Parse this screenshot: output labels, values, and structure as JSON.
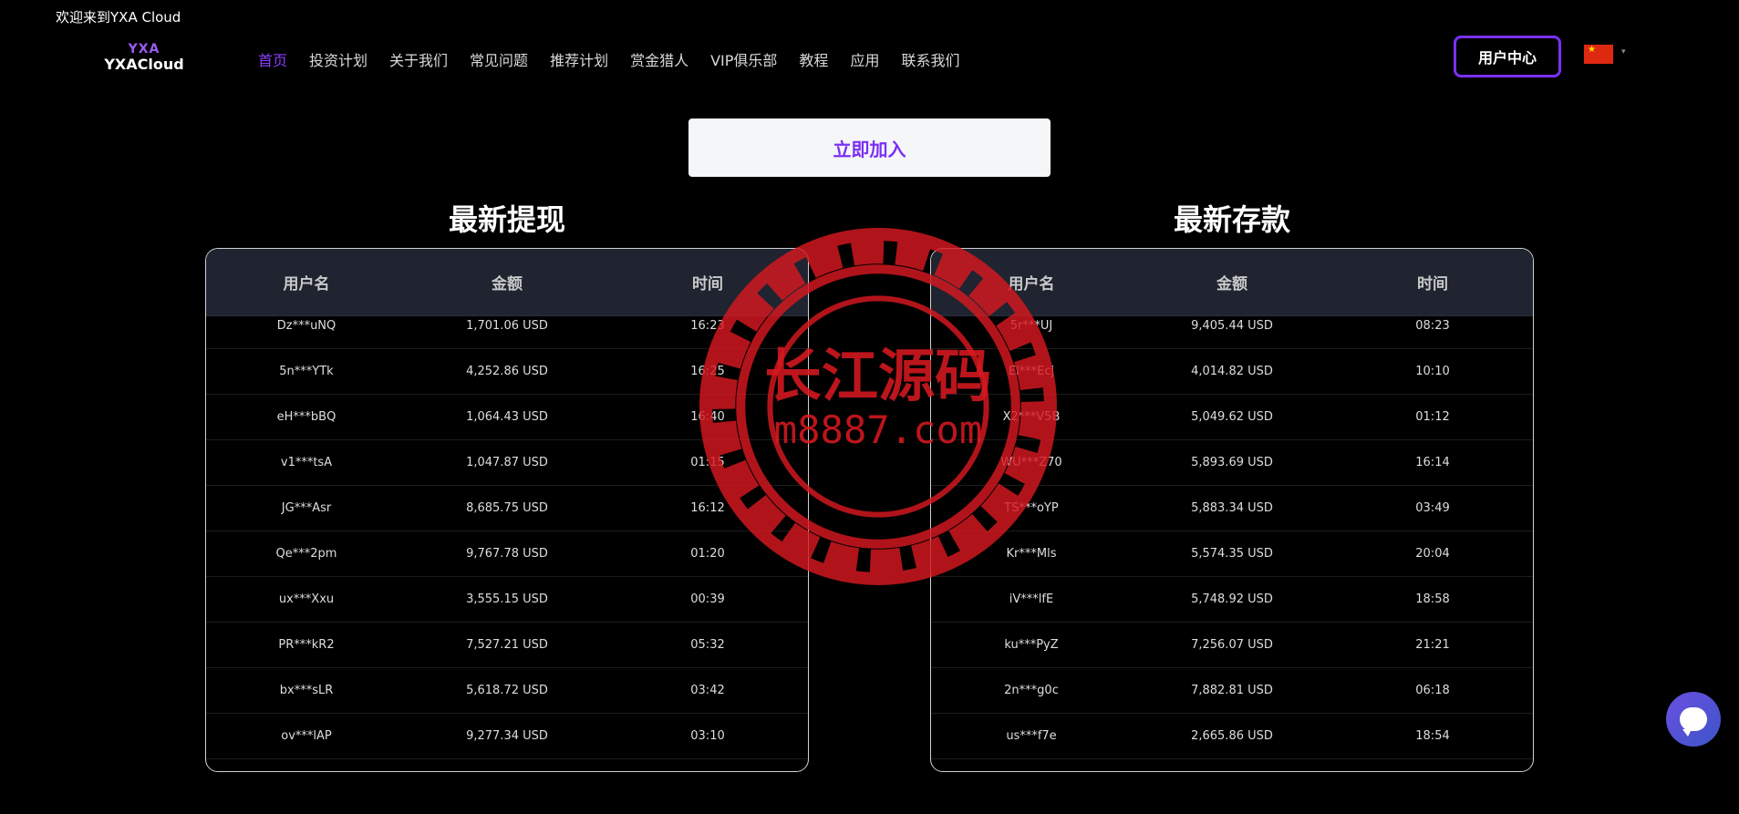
{
  "header": {
    "welcome": "欢迎来到YXA Cloud",
    "logo_top": "YXA",
    "logo_bottom": "YXACloud",
    "user_center": "用户中心"
  },
  "nav": {
    "items": [
      {
        "label": "首页",
        "active": true
      },
      {
        "label": "投资计划"
      },
      {
        "label": "关于我们"
      },
      {
        "label": "常见问题"
      },
      {
        "label": "推荐计划"
      },
      {
        "label": "赏金猎人"
      },
      {
        "label": "VIP俱乐部"
      },
      {
        "label": "教程"
      },
      {
        "label": "应用"
      },
      {
        "label": "联系我们"
      }
    ]
  },
  "join_button": "立即加入",
  "withdraw": {
    "title": "最新提现",
    "columns": [
      "用户名",
      "金额",
      "时间"
    ],
    "rows": [
      [
        "Dz***uNQ",
        "1,701.06 USD",
        "16:23"
      ],
      [
        "5n***YTk",
        "4,252.86 USD",
        "16:25"
      ],
      [
        "eH***bBQ",
        "1,064.43 USD",
        "16:40"
      ],
      [
        "v1***tsA",
        "1,047.87 USD",
        "01:15"
      ],
      [
        "JG***Asr",
        "8,685.75 USD",
        "16:12"
      ],
      [
        "Qe***2pm",
        "9,767.78 USD",
        "01:20"
      ],
      [
        "ux***Xxu",
        "3,555.15 USD",
        "00:39"
      ],
      [
        "PR***kR2",
        "7,527.21 USD",
        "05:32"
      ],
      [
        "bx***sLR",
        "5,618.72 USD",
        "03:42"
      ],
      [
        "ov***lAP",
        "9,277.34 USD",
        "03:10"
      ]
    ]
  },
  "deposit": {
    "title": "最新存款",
    "columns": [
      "用户名",
      "金额",
      "时间"
    ],
    "rows": [
      [
        "5r***UJ",
        "9,405.44 USD",
        "08:23"
      ],
      [
        "El***Ecj",
        "4,014.82 USD",
        "10:10"
      ],
      [
        "X2***V5B",
        "5,049.62 USD",
        "01:12"
      ],
      [
        "WU***Z70",
        "5,893.69 USD",
        "16:14"
      ],
      [
        "TS***oYP",
        "5,883.34 USD",
        "03:49"
      ],
      [
        "Kr***Mls",
        "5,574.35 USD",
        "20:04"
      ],
      [
        "iV***lfE",
        "5,748.92 USD",
        "18:58"
      ],
      [
        "ku***PyZ",
        "7,256.07 USD",
        "21:21"
      ],
      [
        "2n***g0c",
        "7,882.81 USD",
        "06:18"
      ],
      [
        "us***f7e",
        "2,665.86 USD",
        "18:54"
      ]
    ]
  },
  "watermark": {
    "line1": "长江源码",
    "line2": "m8887.com"
  },
  "colors": {
    "accent": "#7b2ff7",
    "active_nav": "#8a3ffc",
    "table_header_bg": "#1f2430",
    "watermark_red": "#d71920"
  }
}
